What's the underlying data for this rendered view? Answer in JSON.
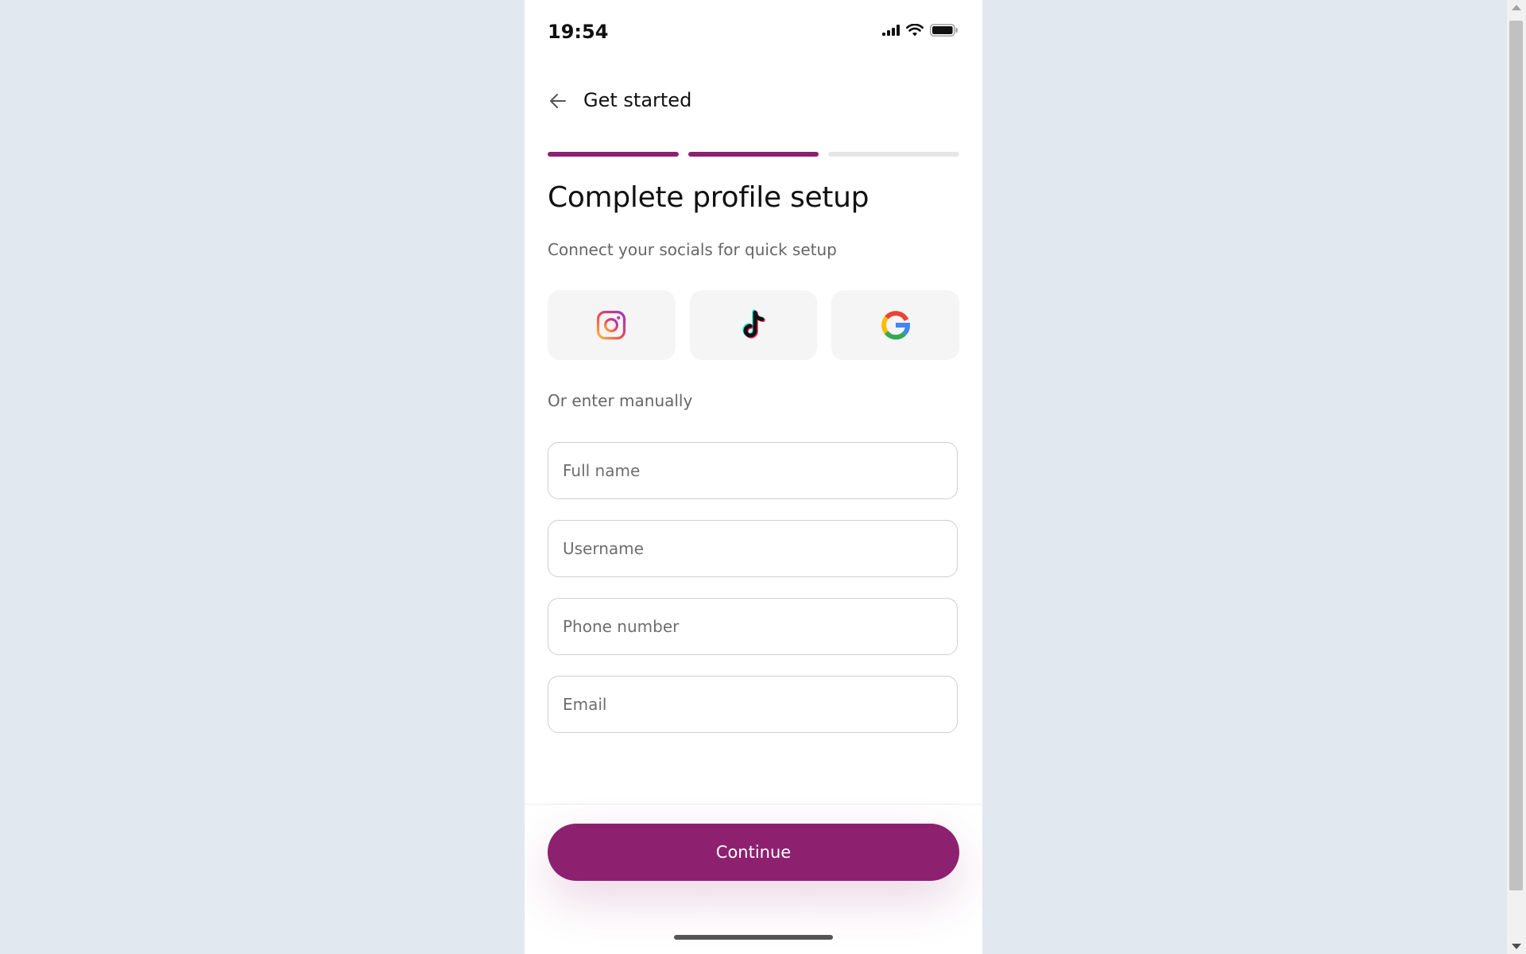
{
  "status_bar": {
    "time": "19:54",
    "icons": [
      "signal-icon",
      "wifi-icon",
      "battery-icon"
    ]
  },
  "header": {
    "back_icon": "arrow-left-icon",
    "title": "Get started"
  },
  "progress": {
    "total_steps": 3,
    "completed_steps": 2,
    "active_color": "#8d2170",
    "inactive_color": "#e6e6e6"
  },
  "main": {
    "title": "Complete profile setup",
    "subtitle": "Connect your socials for quick setup",
    "socials": [
      {
        "name": "instagram",
        "icon": "instagram-icon"
      },
      {
        "name": "tiktok",
        "icon": "tiktok-icon"
      },
      {
        "name": "google",
        "icon": "google-icon"
      }
    ],
    "manual_label": "Or enter manually",
    "fields": {
      "full_name": {
        "placeholder": "Full name",
        "value": ""
      },
      "username": {
        "placeholder": "Username",
        "value": ""
      },
      "phone": {
        "placeholder": "Phone number",
        "value": ""
      },
      "email": {
        "placeholder": "Email",
        "value": ""
      }
    }
  },
  "footer": {
    "continue_label": "Continue"
  },
  "colors": {
    "accent": "#8d2170",
    "page_background": "#e1e8f0"
  }
}
